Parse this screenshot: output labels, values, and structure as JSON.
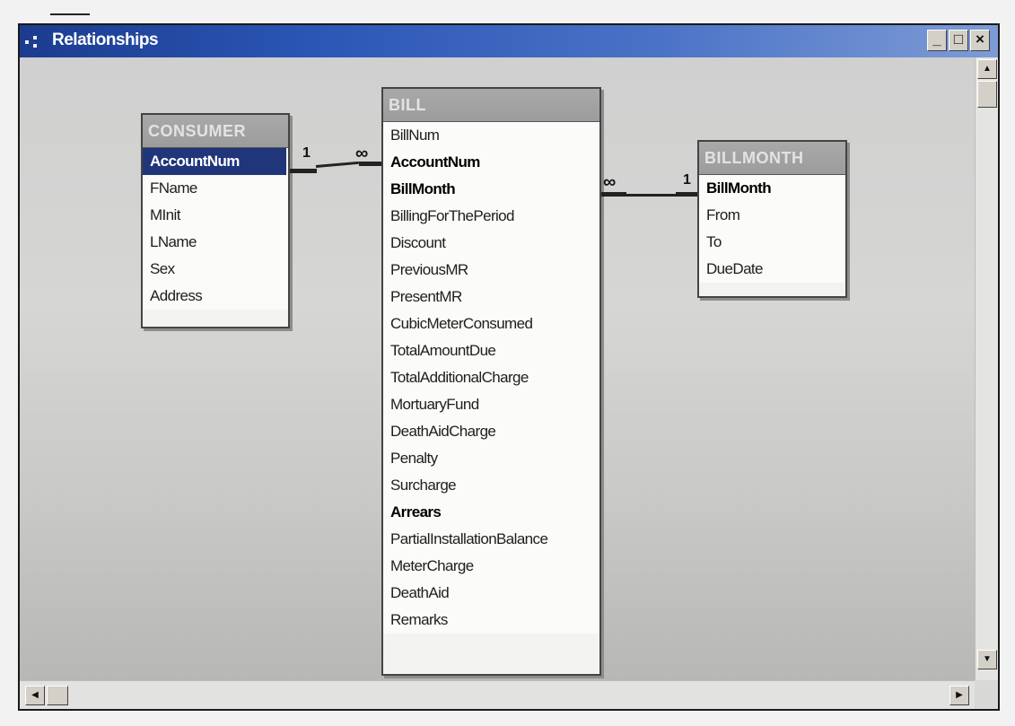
{
  "window": {
    "title": "Relationships",
    "controls": {
      "minimize": "_",
      "maximize": "□",
      "close": "×"
    }
  },
  "tables": {
    "consumer": {
      "name": "CONSUMER",
      "fields": [
        {
          "label": "AccountNum",
          "key": true,
          "selected": true
        },
        {
          "label": "FName"
        },
        {
          "label": "MInit"
        },
        {
          "label": "LName"
        },
        {
          "label": "Sex"
        },
        {
          "label": "Address"
        }
      ]
    },
    "bill": {
      "name": "BILL",
      "fields": [
        {
          "label": "BillNum"
        },
        {
          "label": "AccountNum",
          "key": true
        },
        {
          "label": "BillMonth",
          "key": true
        },
        {
          "label": "BillingForThePeriod"
        },
        {
          "label": "Discount"
        },
        {
          "label": "PreviousMR"
        },
        {
          "label": "PresentMR"
        },
        {
          "label": "CubicMeterConsumed"
        },
        {
          "label": "TotalAmountDue"
        },
        {
          "label": "TotalAdditionalCharge"
        },
        {
          "label": "MortuaryFund"
        },
        {
          "label": "DeathAidCharge"
        },
        {
          "label": "Penalty"
        },
        {
          "label": "Surcharge"
        },
        {
          "label": "Arrears",
          "key": true
        },
        {
          "label": "PartialInstallationBalance"
        },
        {
          "label": "MeterCharge"
        },
        {
          "label": "DeathAid"
        },
        {
          "label": "Remarks"
        }
      ]
    },
    "billmonth": {
      "name": "BILLMONTH",
      "fields": [
        {
          "label": "BillMonth",
          "key": true
        },
        {
          "label": "From"
        },
        {
          "label": "To"
        },
        {
          "label": "DueDate"
        }
      ]
    }
  },
  "relationships": {
    "consumer_bill": {
      "one": "1",
      "many": "∞"
    },
    "bill_billmonth": {
      "many": "∞",
      "one": "1"
    }
  },
  "colors": {
    "title_bar": "#2b56b5",
    "selected_field": "#20357a",
    "table_header": "#a3a3a3"
  }
}
